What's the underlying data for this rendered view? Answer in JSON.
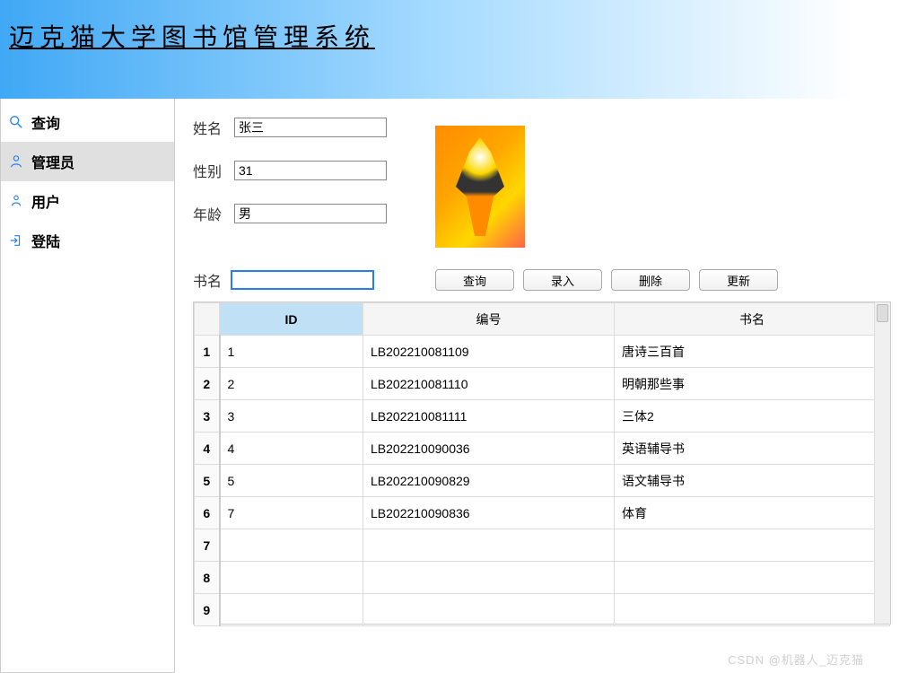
{
  "header": {
    "title": "迈克猫大学图书馆管理系统"
  },
  "sidebar": {
    "items": [
      {
        "label": "查询",
        "icon": "search"
      },
      {
        "label": "管理员",
        "icon": "person"
      },
      {
        "label": "用户",
        "icon": "user"
      },
      {
        "label": "登陆",
        "icon": "login"
      }
    ],
    "active_index": 1
  },
  "form": {
    "name_label": "姓名",
    "name_value": "张三",
    "gender_label": "性别",
    "gender_value": "31",
    "age_label": "年龄",
    "age_value": "男"
  },
  "search": {
    "label": "书名",
    "value": ""
  },
  "buttons": {
    "query": "查询",
    "insert": "录入",
    "delete": "删除",
    "update": "更新"
  },
  "table": {
    "headers": {
      "id": "ID",
      "code": "编号",
      "name": "书名"
    },
    "rows": [
      {
        "n": "1",
        "id": "1",
        "code": "LB202210081109",
        "name": "唐诗三百首"
      },
      {
        "n": "2",
        "id": "2",
        "code": "LB202210081110",
        "name": "明朝那些事"
      },
      {
        "n": "3",
        "id": "3",
        "code": "LB202210081111",
        "name": "三体2"
      },
      {
        "n": "4",
        "id": "4",
        "code": "LB202210090036",
        "name": "英语辅导书"
      },
      {
        "n": "5",
        "id": "5",
        "code": "LB202210090829",
        "name": "语文辅导书"
      },
      {
        "n": "6",
        "id": "7",
        "code": "LB202210090836",
        "name": "体育"
      },
      {
        "n": "7",
        "id": "",
        "code": "",
        "name": ""
      },
      {
        "n": "8",
        "id": "",
        "code": "",
        "name": ""
      },
      {
        "n": "9",
        "id": "",
        "code": "",
        "name": ""
      }
    ]
  },
  "watermark": "CSDN @机器人_迈克猫"
}
